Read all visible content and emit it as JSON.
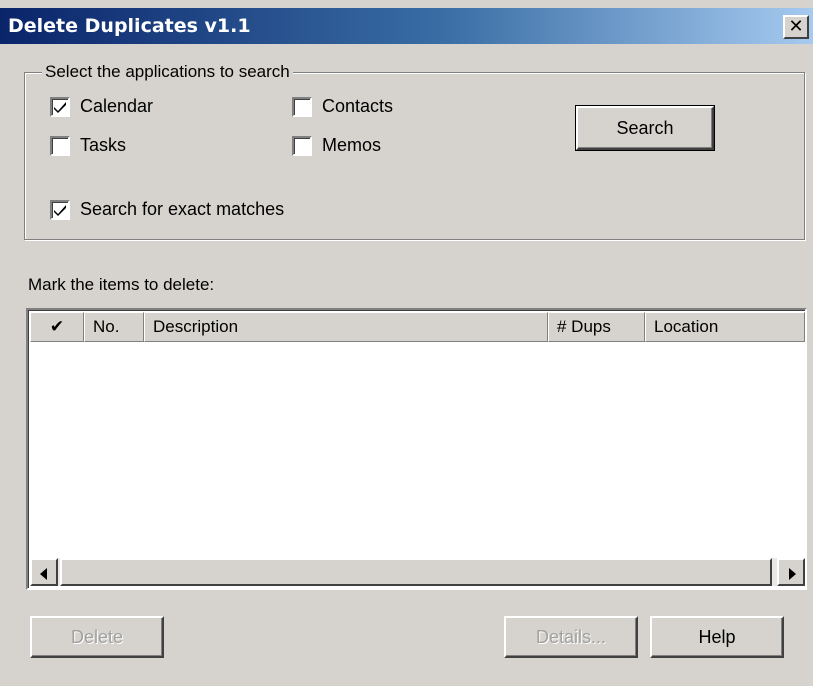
{
  "window": {
    "title": "Delete Duplicates v1.1",
    "close_glyph": "✕"
  },
  "applications": {
    "legend": "Select the applications to search",
    "options": [
      {
        "label": "Calendar",
        "checked": true
      },
      {
        "label": "Contacts",
        "checked": false
      },
      {
        "label": "Tasks",
        "checked": false
      },
      {
        "label": "Memos",
        "checked": false
      }
    ],
    "exact": {
      "label": "Search for exact matches",
      "checked": true
    },
    "search_button": "Search"
  },
  "items": {
    "label": "Mark the items to delete:",
    "columns": [
      {
        "label": "✔",
        "width": 54
      },
      {
        "label": "No.",
        "width": 60
      },
      {
        "label": "Description",
        "width": 404
      },
      {
        "label": "# Dups",
        "width": 97
      },
      {
        "label": "Location",
        "width": 160
      }
    ],
    "rows": []
  },
  "buttons": {
    "delete": "Delete",
    "details": "Details...",
    "help": "Help"
  },
  "colors": {
    "titlebar_start": "#0a246a",
    "titlebar_end": "#a6caf0",
    "face": "#d6d3ce",
    "disabled_text": "#a0a0a0"
  }
}
